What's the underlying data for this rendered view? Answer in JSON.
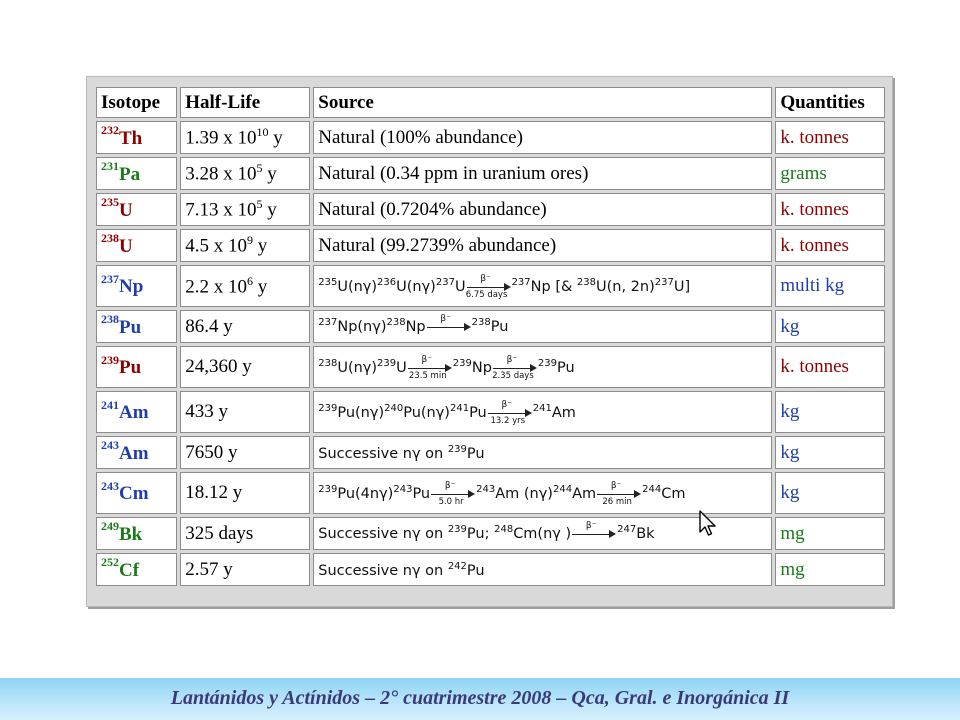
{
  "table": {
    "headers": [
      "Isotope",
      "Half-Life",
      "Source",
      "Quantities"
    ],
    "rows": [
      {
        "mass": "232",
        "element": "Th",
        "half_base": "1.39 x 10",
        "half_exp": "10",
        "half_unit": " y",
        "source": "Natural (100% abundance)",
        "quantity": "k. tonnes",
        "color": "#8b0000"
      },
      {
        "mass": "231",
        "element": "Pa",
        "half_base": "3.28 x 10",
        "half_exp": "5",
        "half_unit": " y",
        "source": "Natural (0.34 ppm in uranium ores)",
        "quantity": "grams",
        "color": "#1a7a1a"
      },
      {
        "mass": "235",
        "element": "U",
        "half_base": "7.13 x 10",
        "half_exp": "5",
        "half_unit": " y",
        "source": "Natural (0.7204% abundance)",
        "quantity": "k. tonnes",
        "color": "#8b0000"
      },
      {
        "mass": "238",
        "element": "U",
        "half_base": "4.5 x 10",
        "half_exp": "9",
        "half_unit": " y",
        "source": "Natural (99.2739% abundance)",
        "quantity": "k. tonnes",
        "color": "#8b0000"
      },
      {
        "mass": "237",
        "element": "Np",
        "half_base": "2.2 x 10",
        "half_exp": "6",
        "half_unit": " y",
        "source_eq": "np237",
        "quantity": "multi kg",
        "color": "#1f3fa8"
      },
      {
        "mass": "238",
        "element": "Pu",
        "half_text": "86.4 y",
        "source_eq": "pu238",
        "quantity": "kg",
        "color": "#1f3fa8"
      },
      {
        "mass": "239",
        "element": "Pu",
        "half_text": "24,360 y",
        "source_eq": "pu239",
        "quantity": "k. tonnes",
        "color": "#8b0000"
      },
      {
        "mass": "241",
        "element": "Am",
        "half_text": "433 y",
        "source_eq": "am241",
        "quantity": "kg",
        "color": "#1f3fa8"
      },
      {
        "mass": "243",
        "element": "Am",
        "half_text": "7650 y",
        "source_eq": "am243",
        "quantity": "kg",
        "color": "#1f3fa8"
      },
      {
        "mass": "243",
        "element": "Cm",
        "half_text": "18.12 y",
        "source_eq": "cm243",
        "quantity": "kg",
        "color": "#1f3fa8"
      },
      {
        "mass": "249",
        "element": "Bk",
        "half_text": "325 days",
        "source_eq": "bk249",
        "quantity": "mg",
        "color": "#1a7a1a"
      },
      {
        "mass": "252",
        "element": "Cf",
        "half_text": "2.57 y",
        "source_eq": "cf252",
        "quantity": "mg",
        "color": "#1a7a1a"
      }
    ]
  },
  "equations": {
    "np237": {
      "m1": "235",
      "t1": "U(nγ)",
      "m2": "236",
      "t2": "U(nγ)",
      "m3": "237",
      "t3": "U",
      "a_top": "β⁻",
      "a_bot": "6.75 days",
      "m4": "237",
      "t4": "Np [& ",
      "m5": "238",
      "t5": "U(n, 2n)",
      "m6": "237",
      "t6": "U]"
    },
    "pu238": {
      "m1": "237",
      "t1": "Np(nγ)",
      "m2": "238",
      "t2": "Np",
      "a_top": "β⁻",
      "a_bot": "",
      "m3": "238",
      "t3": "Pu"
    },
    "pu239": {
      "m1": "238",
      "t1": "U(nγ)",
      "m2": "239",
      "t2": "U",
      "a1_top": "β⁻",
      "a1_bot": "23.5 min",
      "m3": "239",
      "t3": "Np",
      "a2_top": "β⁻",
      "a2_bot": "2.35 days",
      "m4": "239",
      "t4": "Pu"
    },
    "am241": {
      "m1": "239",
      "t1": "Pu(nγ)",
      "m2": "240",
      "t2": "Pu(nγ)",
      "m3": "241",
      "t3": "Pu",
      "a_top": "β⁻",
      "a_bot": "13.2 yrs",
      "m4": "241",
      "t4": "Am"
    },
    "am243": {
      "t1": "Successive nγ on ",
      "m1": "239",
      "t2": "Pu"
    },
    "cm243": {
      "m1": "239",
      "t1": "Pu(4nγ)",
      "m2": "243",
      "t2": "Pu",
      "a1_top": "β⁻",
      "a1_bot": "5.0 hr",
      "m3": "243",
      "t3": "Am (nγ)",
      "m4": "244",
      "t4": "Am",
      "a2_top": "β⁻",
      "a2_bot": "26 min",
      "m5": "244",
      "t5": "Cm"
    },
    "bk249": {
      "t1": "Successive nγ on ",
      "m1": "239",
      "t2": "Pu; ",
      "m2": "248",
      "t3": "Cm(nγ )",
      "a_top": "β⁻",
      "m3": "247",
      "t4": "Bk"
    },
    "cf252": {
      "t1": "Successive nγ on ",
      "m1": "242",
      "t2": "Pu"
    }
  },
  "footer": {
    "text": "Lantánidos y Actínidos – 2° cuatrimestre 2008 – Qca, Gral. e Inorgánica II"
  },
  "colors": {
    "heavy_quantity": "#8b0000",
    "medium_quantity": "#1a7a1a",
    "light_quantity": "#1f3fa8",
    "footer_text": "#3a3a7a"
  },
  "icons": {
    "cursor": "mouse-pointer-icon"
  }
}
